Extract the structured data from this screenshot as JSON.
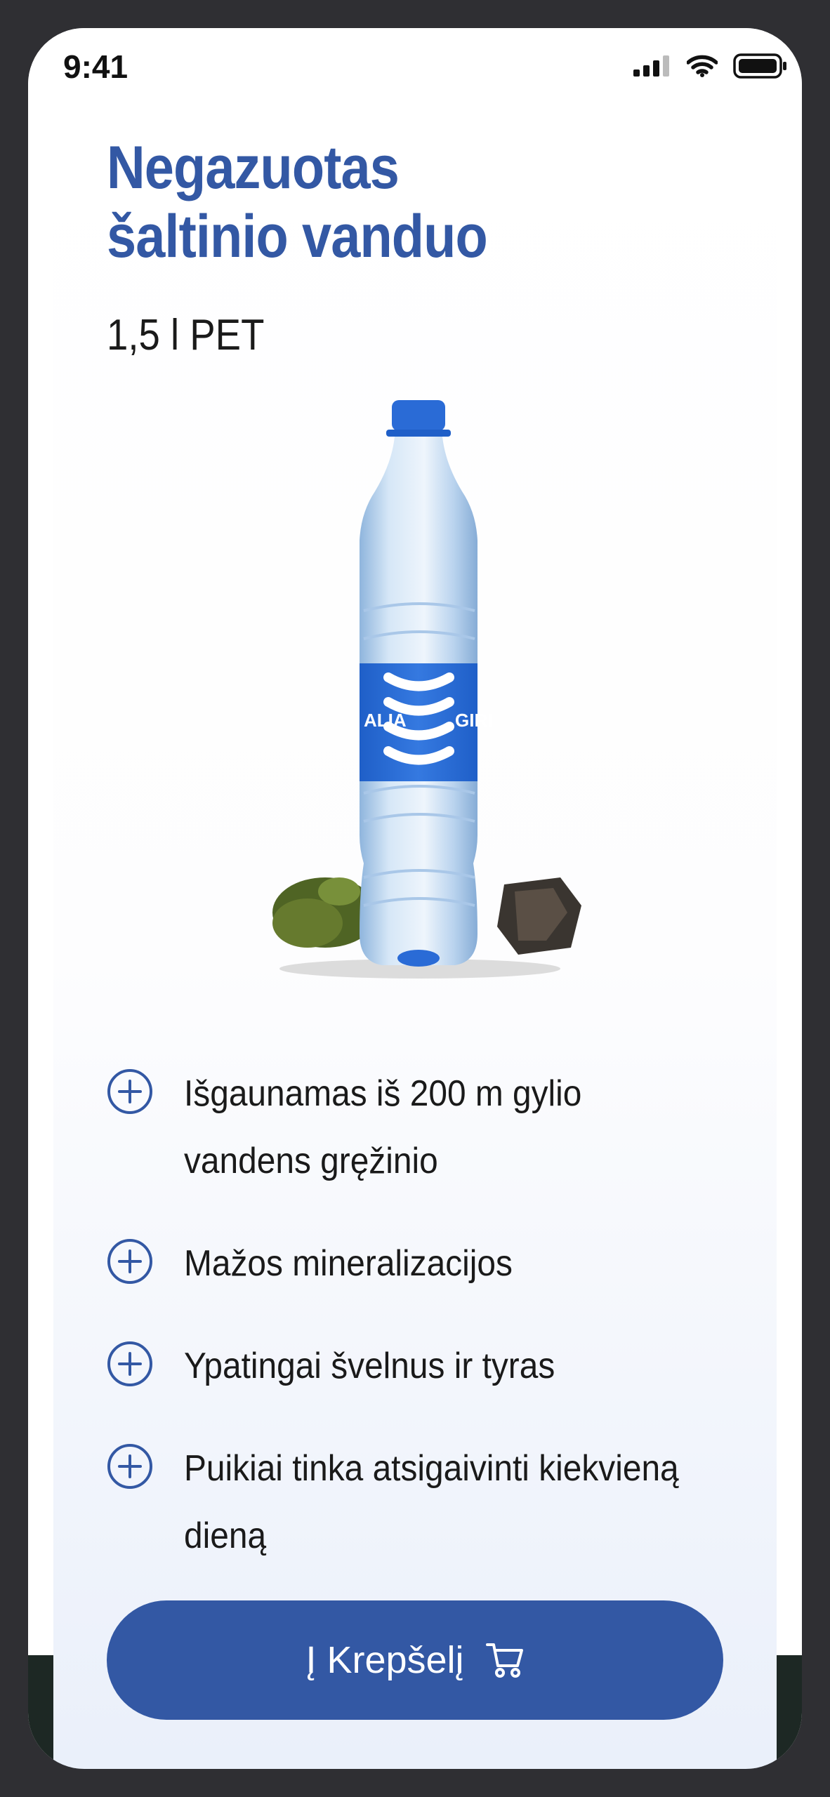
{
  "status_bar": {
    "time": "9:41",
    "icons": [
      "cellular-signal-icon",
      "wifi-icon",
      "battery-icon"
    ]
  },
  "product": {
    "title_line1": "Negazuotas",
    "title_line2": "šaltinio vanduo",
    "volume": "1,5 l PET",
    "image": {
      "subject": "water-bottle",
      "label_left": "ALIA",
      "label_right": "GIRI"
    }
  },
  "features": [
    {
      "icon": "plus-circle-icon",
      "text": "Išgaunamas iš 200 m gylio vandens gręžinio"
    },
    {
      "icon": "plus-circle-icon",
      "text": "Mažos mineralizacijos"
    },
    {
      "icon": "plus-circle-icon",
      "text": "Ypatingai švelnus ir tyras"
    },
    {
      "icon": "plus-circle-icon",
      "text": "Puikiai tinka atsigaivinti kiekvieną dieną"
    }
  ],
  "cart_button": {
    "label": "Į Krepšelį",
    "icon": "shopping-cart-icon"
  },
  "colors": {
    "brand_blue": "#3358a4",
    "bottle_blue": "#2a6bd6",
    "text": "#1a1a1a",
    "frame": "#2f2f33"
  }
}
